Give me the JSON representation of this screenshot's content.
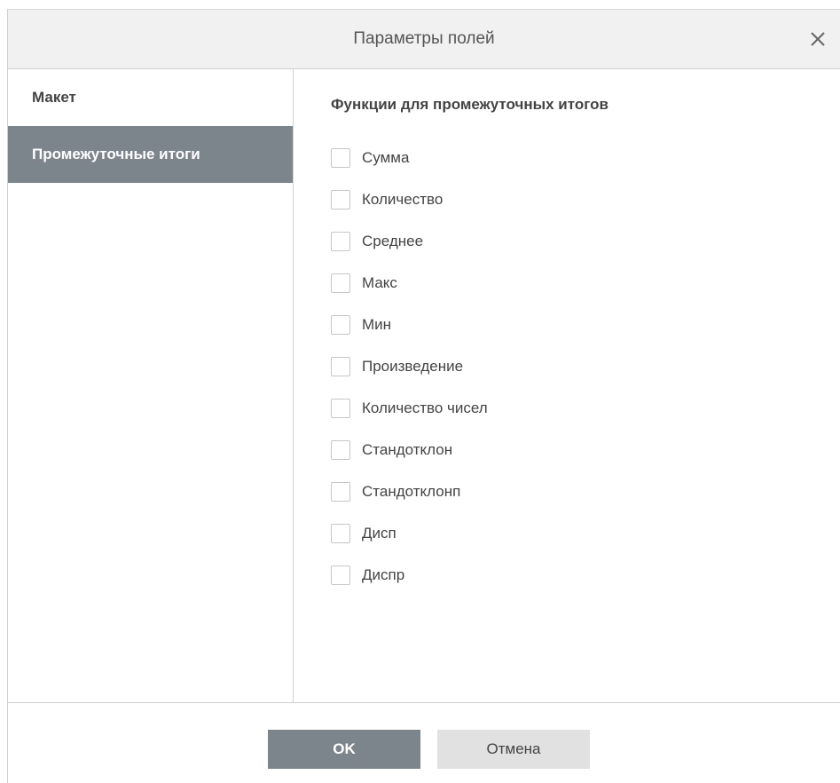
{
  "dialog": {
    "title": "Параметры полей"
  },
  "sidebar": {
    "items": [
      {
        "label": "Макет",
        "active": false
      },
      {
        "label": "Промежуточные итоги",
        "active": true
      }
    ]
  },
  "content": {
    "section_title": "Функции для промежуточных итогов",
    "options": [
      {
        "label": "Сумма",
        "checked": false
      },
      {
        "label": "Количество",
        "checked": false
      },
      {
        "label": "Среднее",
        "checked": false
      },
      {
        "label": "Макс",
        "checked": false
      },
      {
        "label": "Мин",
        "checked": false
      },
      {
        "label": "Произведение",
        "checked": false
      },
      {
        "label": "Количество чисел",
        "checked": false
      },
      {
        "label": "Стандотклон",
        "checked": false
      },
      {
        "label": "Стандотклонп",
        "checked": false
      },
      {
        "label": "Дисп",
        "checked": false
      },
      {
        "label": "Диспр",
        "checked": false
      }
    ]
  },
  "footer": {
    "ok_label": "OK",
    "cancel_label": "Отмена"
  },
  "colors": {
    "accent": "#7d858c",
    "header_bg": "#f1f1f1",
    "cancel_bg": "#e1e1e1"
  }
}
